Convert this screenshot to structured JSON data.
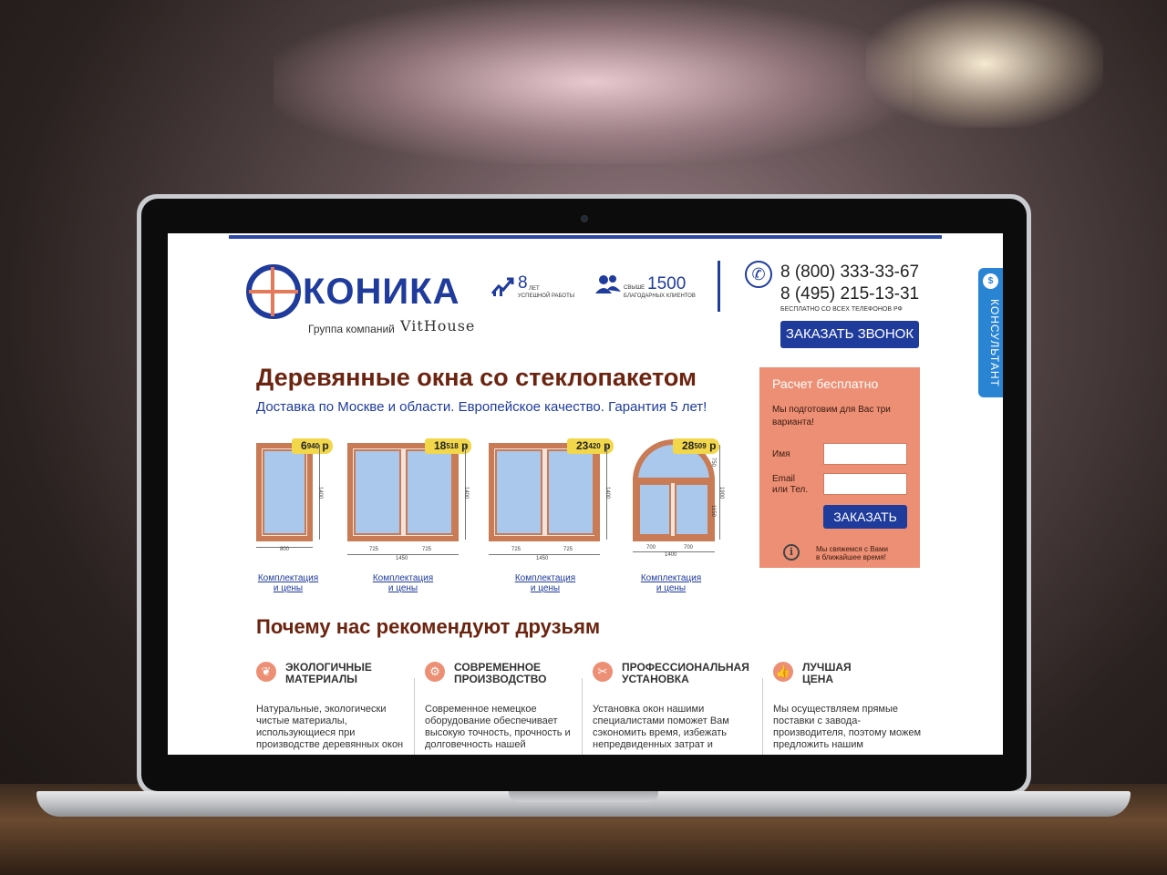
{
  "logo": {
    "name": "КОНИКА",
    "group_label": "Группа компаний",
    "brand": "VitHouse"
  },
  "stats": [
    {
      "icon": "chart-up-icon",
      "number": "8",
      "caption_line1": "лет",
      "caption_line2": "успешной работы"
    },
    {
      "icon": "users-icon",
      "prefix": "свыше",
      "number": "1500",
      "caption_line1": "благодарных клиентов"
    }
  ],
  "contacts": {
    "phone1": "8 (800) 333-33-67",
    "phone2": "8 (495) 215-13-31",
    "note": "бесплатно со всех телефонов РФ",
    "callback_label": "ЗАКАЗАТЬ ЗВОНОК"
  },
  "hero": {
    "title": "Деревянные окна со стеклопакетом",
    "subtitle": "Доставка по Москве и области. Европейское качество. Гарантия 5 лет!"
  },
  "windows": [
    {
      "price_main": "6",
      "price_small": "940",
      "currency": "р",
      "height": "1400",
      "widths": [
        "800"
      ],
      "link_line1": "Комплектация",
      "link_line2": "и цены"
    },
    {
      "price_main": "18",
      "price_small": "518",
      "currency": "р",
      "height": "1400",
      "widths": [
        "725",
        "725"
      ],
      "total_width": "1450",
      "link_line1": "Комплектация",
      "link_line2": "и цены"
    },
    {
      "price_main": "23",
      "price_small": "420",
      "currency": "р",
      "height": "1400",
      "widths": [
        "725",
        "725"
      ],
      "total_width": "1450",
      "link_line1": "Комплектация",
      "link_line2": "и цены"
    },
    {
      "price_main": "28",
      "price_small": "509",
      "currency": "р",
      "heights": [
        "750",
        "1150",
        "1900"
      ],
      "widths": [
        "700",
        "700"
      ],
      "total_width": "1400",
      "link_line1": "Комплектация",
      "link_line2": "и цены"
    }
  ],
  "form": {
    "title": "Расчет бесплатно",
    "description": "Мы подготовим для Вас три варианта!",
    "name_label": "Имя",
    "contact_label_line1": "Email",
    "contact_label_line2": "или Тел.",
    "name_value": "",
    "contact_value": "",
    "submit_label": "ЗАКАЗАТЬ",
    "note_line1": "Мы свяжемся с Вами",
    "note_line2": "в ближайшее время!"
  },
  "consultant": {
    "label": "КОНСУЛЬТАНТ"
  },
  "why": {
    "title": "Почему нас рекомендуют друзьям",
    "features": [
      {
        "icon": "leaf-icon",
        "title_line1": "Экологичные",
        "title_line2": "материалы",
        "text": "Натуральные, экологически чистые материалы, использующиеся при производстве деревянных окон"
      },
      {
        "icon": "gear-icon",
        "title_line1": "Современное",
        "title_line2": "производство",
        "text": "Современное немецкое оборудование обеспечивает высокую точность, прочность и долговечность нашей"
      },
      {
        "icon": "tools-icon",
        "title_line1": "Профессиональная",
        "title_line2": "установка",
        "text": "Установка окон нашими специалистами поможет Вам сэкономить время, избежать непредвиденных затрат и"
      },
      {
        "icon": "thumbs-up-icon",
        "title_line1": "Лучшая",
        "title_line2": "цена",
        "text": "Мы осуществляем прямые поставки с завода-производителя, поэтому можем предложить нашим"
      }
    ]
  },
  "colors": {
    "brand_blue": "#1f3b9c",
    "accent_salmon": "#ec8f74",
    "heading_brown": "#6b2410",
    "price_tag": "#f2d74a"
  }
}
